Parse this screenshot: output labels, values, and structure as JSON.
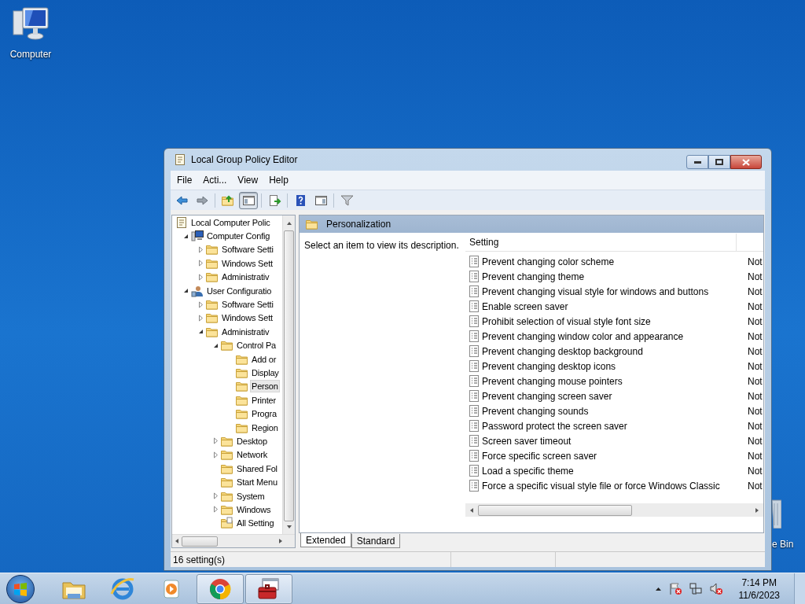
{
  "desktop_icons": [
    {
      "label": "Computer",
      "kind": "computer"
    },
    {
      "label": "e Bin",
      "kind": "recycle-bin"
    }
  ],
  "window": {
    "title": "Local Group Policy Editor"
  },
  "menu": [
    "File",
    "Acti...",
    "View",
    "Help"
  ],
  "toolbar": [
    {
      "kind": "back",
      "selected": false
    },
    {
      "kind": "forward",
      "selected": false
    },
    {
      "kind": "up",
      "selected": false
    },
    {
      "kind": "show-tree",
      "selected": true
    },
    {
      "kind": "export",
      "selected": false
    },
    {
      "kind": "help",
      "selected": false
    },
    {
      "kind": "show-action",
      "selected": false
    },
    {
      "kind": "filter",
      "selected": false
    }
  ],
  "tree": [
    {
      "label": "Local Computer Polic",
      "kind": "policy",
      "selected": false,
      "children": [
        {
          "label": "Computer Config",
          "kind": "computer",
          "selected": false,
          "expanded": true,
          "children": [
            {
              "label": "Software Setti",
              "kind": "folder",
              "selected": false,
              "expanded": false
            },
            {
              "label": "Windows Sett",
              "kind": "folder",
              "selected": false,
              "expanded": false
            },
            {
              "label": "Administrativ",
              "kind": "folder",
              "selected": false,
              "expanded": false
            }
          ]
        },
        {
          "label": "User Configuratio",
          "kind": "user",
          "selected": false,
          "expanded": true,
          "children": [
            {
              "label": "Software Setti",
              "kind": "folder",
              "selected": false,
              "expanded": false
            },
            {
              "label": "Windows Sett",
              "kind": "folder",
              "selected": false,
              "expanded": false
            },
            {
              "label": "Administrativ",
              "kind": "folder",
              "selected": false,
              "expanded": true,
              "children": [
                {
                  "label": "Control Pa",
                  "kind": "folder",
                  "selected": false,
                  "expanded": true,
                  "children": [
                    {
                      "label": "Add or",
                      "kind": "folder",
                      "selected": false
                    },
                    {
                      "label": "Display",
                      "kind": "folder",
                      "selected": false
                    },
                    {
                      "label": "Person",
                      "kind": "folder",
                      "selected": true
                    },
                    {
                      "label": "Printer",
                      "kind": "folder",
                      "selected": false
                    },
                    {
                      "label": "Progra",
                      "kind": "folder",
                      "selected": false
                    },
                    {
                      "label": "Region",
                      "kind": "folder",
                      "selected": false
                    }
                  ]
                },
                {
                  "label": "Desktop",
                  "kind": "folder",
                  "selected": false,
                  "expanded": false
                },
                {
                  "label": "Network",
                  "kind": "folder",
                  "selected": false,
                  "expanded": false
                },
                {
                  "label": "Shared Fol",
                  "kind": "folder",
                  "selected": false
                },
                {
                  "label": "Start Menu",
                  "kind": "folder",
                  "selected": false
                },
                {
                  "label": "System",
                  "kind": "folder",
                  "selected": false,
                  "expanded": false
                },
                {
                  "label": "Windows",
                  "kind": "folder",
                  "selected": false,
                  "expanded": false
                },
                {
                  "label": "All Setting",
                  "kind": "all-settings",
                  "selected": false
                }
              ]
            }
          ]
        }
      ]
    }
  ],
  "details": {
    "header": "Personalization",
    "description": "Select an item to view its description.",
    "columns": [
      "Setting"
    ],
    "rows": [
      {
        "setting": "Prevent changing color scheme",
        "column_2": "Not"
      },
      {
        "setting": "Prevent changing theme",
        "column_2": "Not"
      },
      {
        "setting": "Prevent changing visual style for windows and buttons",
        "column_2": "Not"
      },
      {
        "setting": "Enable screen saver",
        "column_2": "Not"
      },
      {
        "setting": "Prohibit selection of visual style font size",
        "column_2": "Not"
      },
      {
        "setting": "Prevent changing window color and appearance",
        "column_2": "Not"
      },
      {
        "setting": "Prevent changing desktop background",
        "column_2": "Not"
      },
      {
        "setting": "Prevent changing desktop icons",
        "column_2": "Not"
      },
      {
        "setting": "Prevent changing mouse pointers",
        "column_2": "Not"
      },
      {
        "setting": "Prevent changing screen saver",
        "column_2": "Not"
      },
      {
        "setting": "Prevent changing sounds",
        "column_2": "Not"
      },
      {
        "setting": "Password protect the screen saver",
        "column_2": "Not"
      },
      {
        "setting": "Screen saver timeout",
        "column_2": "Not"
      },
      {
        "setting": "Force specific screen saver",
        "column_2": "Not"
      },
      {
        "setting": "Load a specific theme",
        "column_2": "Not"
      },
      {
        "setting": "Force a specific visual style file or force Windows Classic",
        "column_2": "Not"
      }
    ]
  },
  "tabs": [
    {
      "label": "Extended",
      "selected": true
    },
    {
      "label": "Standard",
      "selected": false
    }
  ],
  "status_bar": [
    "16 setting(s)"
  ],
  "taskbar": {
    "apps": [
      {
        "kind": "explorer",
        "active": false
      },
      {
        "kind": "browser-e",
        "active": false
      },
      {
        "kind": "media",
        "active": false
      },
      {
        "kind": "chrome",
        "active": true
      },
      {
        "kind": "toolbox",
        "active": true
      }
    ],
    "tray": [
      {
        "kind": "show-hidden"
      },
      {
        "kind": "flag"
      },
      {
        "kind": "network"
      },
      {
        "kind": "speaker-muted"
      }
    ],
    "time": "7:14 PM",
    "date": "11/6/2023"
  }
}
